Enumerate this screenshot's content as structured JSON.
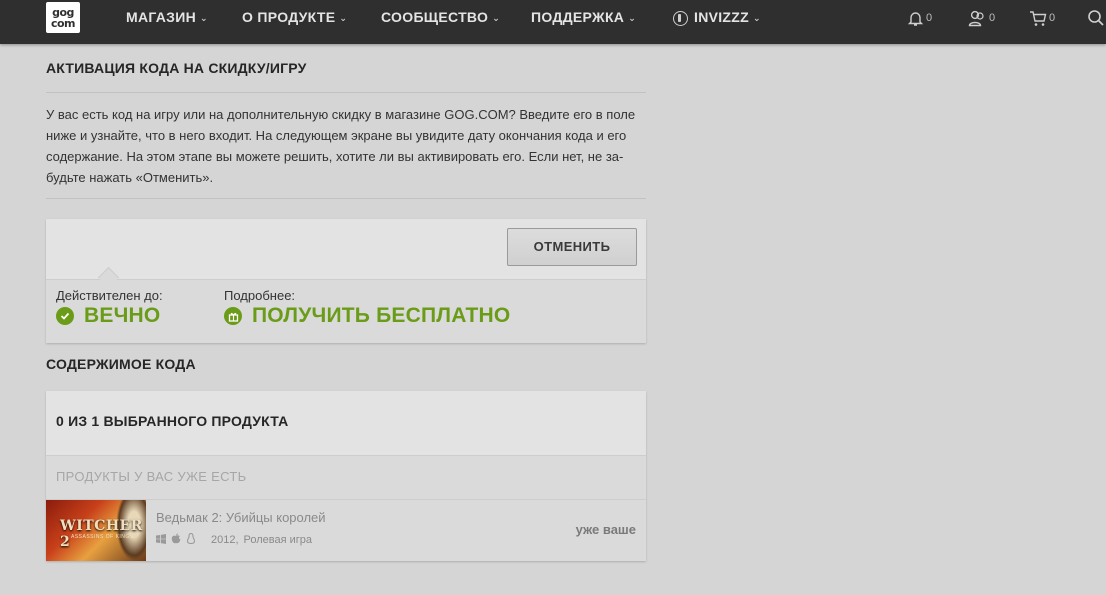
{
  "nav": {
    "logo_line1": "gog",
    "logo_line2": "com",
    "store": "МАГАЗИН",
    "about": "О ПРОДУКТЕ",
    "community": "СООБЩЕСТВО",
    "support": "ПОДДЕРЖКА",
    "user": "INVIZZZ",
    "notifications_count": "0",
    "friends_count": "0",
    "cart_count": "0"
  },
  "page": {
    "title": "АКТИВАЦИЯ КОДА НА СКИДКУ/ИГРУ",
    "intro": "У вас есть код на игру или на дополнительную скидку в магазине GOG.COM? Введите его в поле ниже и узнайте, что в него входит. На следующем экране вы увидите дату окончания кода и его содержание. На этом этапе вы можете решить, хотите ли вы активировать его. Если нет, не за-будьте нажать «Отменить»."
  },
  "code": {
    "cancel_label": "ОТМЕНИТЬ",
    "valid_label": "Действителен до:",
    "valid_value": "ВЕЧНО",
    "details_label": "Подробнее:",
    "details_value": "ПОЛУЧИТЬ БЕСПЛАТНО"
  },
  "contents": {
    "title": "СОДЕРЖИМОЕ КОДА",
    "selected_count": "0 ИЗ 1 ВЫБРАННОГО ПРОДУКТА",
    "owned_header": "ПРОДУКТЫ У ВАС УЖЕ ЕСТЬ",
    "products": [
      {
        "name": "Ведьмак 2: Убийцы королей",
        "year": "2012,",
        "genre": "Ролевая игра",
        "status": "уже ваше",
        "cover_title": "WITCHER 2",
        "cover_subtitle": "ASSASSINS OF KINGS"
      }
    ]
  },
  "colors": {
    "topbar": "#2f2f2f",
    "background": "#d5d5d5",
    "accent_green": "#6a9c18"
  }
}
